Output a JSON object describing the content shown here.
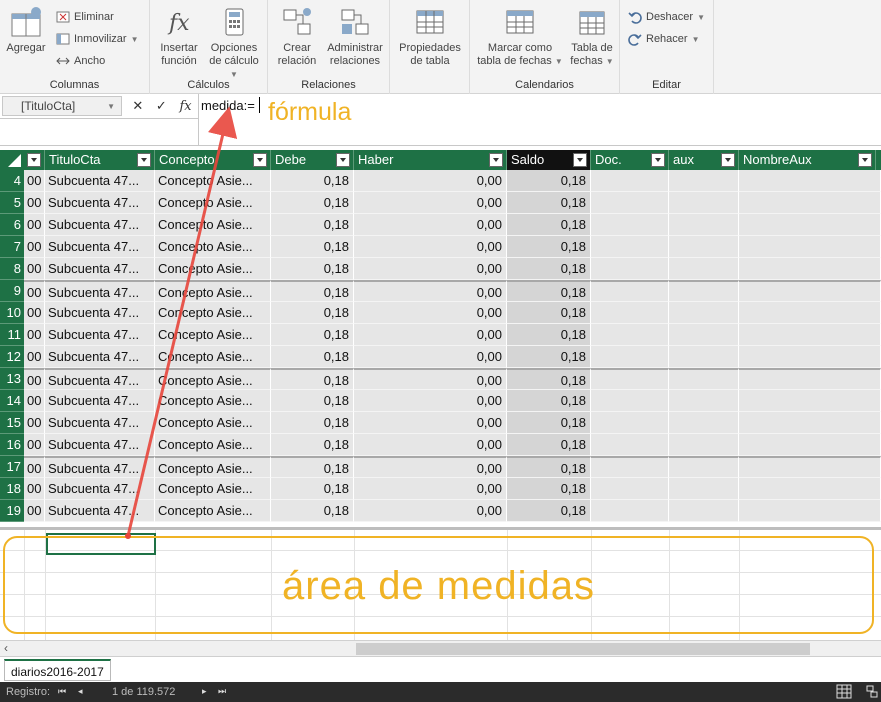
{
  "ribbon": {
    "groups": {
      "columnas": {
        "label": "Columnas",
        "agregar": "Agregar",
        "eliminar": "Eliminar",
        "inmovilizar": "Inmovilizar",
        "ancho": "Ancho"
      },
      "calculos": {
        "label": "Cálculos",
        "insertar_funcion": [
          "Insertar",
          "función"
        ],
        "opciones_calculo": [
          "Opciones",
          "de cálculo"
        ]
      },
      "relaciones": {
        "label": "Relaciones",
        "crear_relacion": [
          "Crear",
          "relación"
        ],
        "administrar_relaciones": [
          "Administrar",
          "relaciones"
        ]
      },
      "tabla": {
        "propiedades_tabla": [
          "Propiedades",
          "de tabla"
        ]
      },
      "calendarios": {
        "label": "Calendarios",
        "marcar_tabla_fechas": [
          "Marcar como",
          "tabla de fechas"
        ],
        "tabla_fechas": [
          "Tabla de",
          "fechas"
        ]
      },
      "editar": {
        "label": "Editar",
        "deshacer": "Deshacer",
        "rehacer": "Rehacer"
      }
    }
  },
  "formula_bar": {
    "name_box": "[TituloCta]",
    "cancel_symbol": "✕",
    "confirm_symbol": "✓",
    "fx_symbol": "fx",
    "formula_text": "medida:="
  },
  "grid": {
    "columns": [
      "TituloCta",
      "Concepto",
      "Debe",
      "Haber",
      "Saldo",
      "Doc.",
      "aux",
      "NombreAux"
    ],
    "rows": [
      {
        "num": "4",
        "pre": "00",
        "titulo": "Subcuenta 47...",
        "concepto": "Concepto Asie...",
        "debe": "0,18",
        "haber": "0,00",
        "saldo": "0,18"
      },
      {
        "num": "5",
        "pre": "00",
        "titulo": "Subcuenta 47...",
        "concepto": "Concepto Asie...",
        "debe": "0,18",
        "haber": "0,00",
        "saldo": "0,18"
      },
      {
        "num": "6",
        "pre": "00",
        "titulo": "Subcuenta 47...",
        "concepto": "Concepto Asie...",
        "debe": "0,18",
        "haber": "0,00",
        "saldo": "0,18"
      },
      {
        "num": "7",
        "pre": "00",
        "titulo": "Subcuenta 47...",
        "concepto": "Concepto Asie...",
        "debe": "0,18",
        "haber": "0,00",
        "saldo": "0,18"
      },
      {
        "num": "8",
        "pre": "00",
        "titulo": "Subcuenta 47...",
        "concepto": "Concepto Asie...",
        "debe": "0,18",
        "haber": "0,00",
        "saldo": "0,18"
      },
      {
        "num": "9",
        "pre": "00",
        "titulo": "Subcuenta 47...",
        "concepto": "Concepto Asie...",
        "debe": "0,18",
        "haber": "0,00",
        "saldo": "0,18"
      },
      {
        "num": "10",
        "pre": "00",
        "titulo": "Subcuenta 47...",
        "concepto": "Concepto Asie...",
        "debe": "0,18",
        "haber": "0,00",
        "saldo": "0,18"
      },
      {
        "num": "11",
        "pre": "00",
        "titulo": "Subcuenta 47...",
        "concepto": "Concepto Asie...",
        "debe": "0,18",
        "haber": "0,00",
        "saldo": "0,18"
      },
      {
        "num": "12",
        "pre": "00",
        "titulo": "Subcuenta 47...",
        "concepto": "Concepto Asie...",
        "debe": "0,18",
        "haber": "0,00",
        "saldo": "0,18"
      },
      {
        "num": "13",
        "pre": "00",
        "titulo": "Subcuenta 47...",
        "concepto": "Concepto Asie...",
        "debe": "0,18",
        "haber": "0,00",
        "saldo": "0,18"
      },
      {
        "num": "14",
        "pre": "00",
        "titulo": "Subcuenta 47...",
        "concepto": "Concepto Asie...",
        "debe": "0,18",
        "haber": "0,00",
        "saldo": "0,18"
      },
      {
        "num": "15",
        "pre": "00",
        "titulo": "Subcuenta 47...",
        "concepto": "Concepto Asie...",
        "debe": "0,18",
        "haber": "0,00",
        "saldo": "0,18"
      },
      {
        "num": "16",
        "pre": "00",
        "titulo": "Subcuenta 47...",
        "concepto": "Concepto Asie...",
        "debe": "0,18",
        "haber": "0,00",
        "saldo": "0,18"
      },
      {
        "num": "17",
        "pre": "00",
        "titulo": "Subcuenta 47...",
        "concepto": "Concepto Asie...",
        "debe": "0,18",
        "haber": "0,00",
        "saldo": "0,18"
      },
      {
        "num": "18",
        "pre": "00",
        "titulo": "Subcuenta 47...",
        "concepto": "Concepto Asie...",
        "debe": "0,18",
        "haber": "0,00",
        "saldo": "0,18"
      },
      {
        "num": "19",
        "pre": "00",
        "titulo": "Subcuenta 47...",
        "concepto": "Concepto Asie...",
        "debe": "0,18",
        "haber": "0,00",
        "saldo": "0,18"
      }
    ]
  },
  "annotations": {
    "formula_label": "fórmula",
    "measures_label": "área de medidas",
    "color": "#f0b325",
    "arrow_color": "#e8463c"
  },
  "sheet_tabs": [
    "diarios2016-2017"
  ],
  "status_bar": {
    "registro_label": "Registro:",
    "record_position": "1 de 119.572"
  },
  "colors": {
    "header_green": "#1e7145",
    "grid_cell": "#e6e6e6"
  }
}
